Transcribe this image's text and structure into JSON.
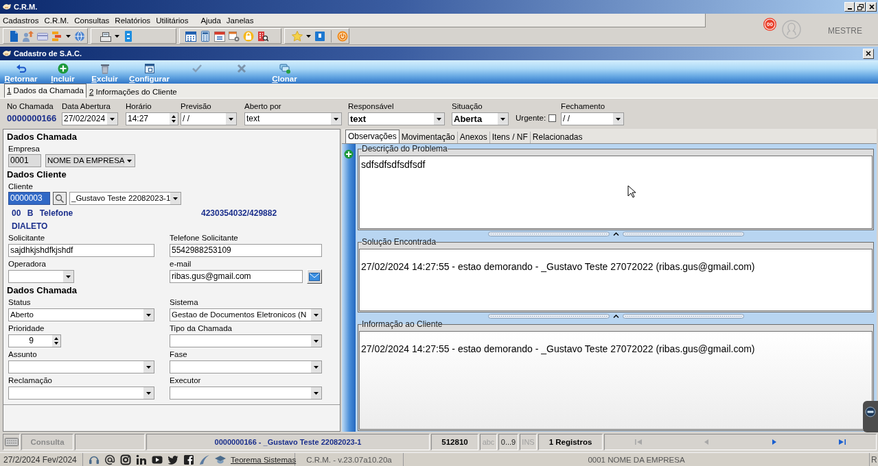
{
  "window": {
    "title": "C.R.M."
  },
  "menu": [
    "Cadastros",
    "C.R.M.",
    "Consultas",
    "Relatórios",
    "Utilitários",
    "Ajuda",
    "Janelas"
  ],
  "user": {
    "notifications": "00",
    "name": "MESTRE"
  },
  "form_window": {
    "title": "Cadastro de S.A.C."
  },
  "actions": [
    {
      "label": "Retornar",
      "disabled": false
    },
    {
      "label": "Incluir",
      "disabled": false
    },
    {
      "label": "Excluir",
      "disabled": false
    },
    {
      "label": "Configurar",
      "disabled": false
    },
    {
      "disabled": true
    },
    {
      "disabled": true
    },
    {
      "label": "Clonar",
      "disabled": false
    }
  ],
  "tabs": [
    {
      "label": "1 Dados da Chamada",
      "selected": true
    },
    {
      "label": "2 Informações do Cliente",
      "selected": false
    }
  ],
  "header_fields": [
    {
      "kind": "display",
      "label": "No Chamada",
      "value": "0000000166"
    },
    {
      "kind": "dropdown",
      "label": "Data Abertura",
      "value": "27/02/2024",
      "bold": false
    },
    {
      "kind": "spinner",
      "label": "Horário",
      "value": "14:27"
    },
    {
      "kind": "dropdown",
      "label": "Previsão",
      "value": "/ /",
      "bold": false
    },
    {
      "kind": "dropdown",
      "label": "Aberto por",
      "value": "text",
      "bold": false
    },
    {
      "kind": "dropdown",
      "label": "Responsável",
      "value": "text",
      "bold": true
    },
    {
      "kind": "dropdown",
      "label": "Situação",
      "value": "Aberta",
      "bold": true
    },
    {
      "kind": "checkbox",
      "label": "Urgente:",
      "checked": false
    },
    {
      "kind": "dropdown",
      "label": "Fechamento",
      "value": "/ /",
      "bold": false
    }
  ],
  "left_panel": {
    "company_heading": "Dados Chamada",
    "company": {
      "label": "Empresa",
      "code": "0001",
      "name": "NOME DA EMPRESA",
      "disabled": true
    },
    "client_heading": "Dados Cliente",
    "client": {
      "label": "Cliente",
      "code": "0000003",
      "code_selected": true,
      "name": "_Gustavo Teste 22082023-1",
      "info": "00 B Telefone",
      "phones": "4230354032/429882",
      "note": "DIALETO"
    },
    "contact_fields": [
      {
        "kind": "text",
        "label": "Solicitante",
        "value": "sajdhkjshdfkjshdf"
      },
      {
        "kind": "text",
        "label": "Telefone Solicitante",
        "value": "5542988253109"
      },
      {
        "kind": "dropdown",
        "label": "Operadora"
      },
      {
        "kind": "email",
        "label": "e-mail",
        "value": "ribas.gus@gmail.com"
      }
    ],
    "call_heading": "Dados Chamada",
    "call_fields": [
      {
        "kind": "dropdown",
        "label": "Status",
        "value": "Aberto"
      },
      {
        "kind": "dropdown",
        "label": "Sistema",
        "value": "Gestao de Documentos Eletronicos (N"
      },
      {
        "kind": "spinner",
        "label": "Prioridade",
        "value": "9"
      },
      {
        "kind": "dropdown",
        "label": "Tipo da Chamada"
      },
      {
        "kind": "dropdown",
        "label": "Assunto"
      },
      {
        "kind": "dropdown",
        "label": "Fase"
      },
      {
        "kind": "dropdown",
        "label": "Reclamação"
      },
      {
        "kind": "dropdown",
        "label": "Executor"
      }
    ]
  },
  "detail_tabs": [
    {
      "label": "Observações",
      "selected": true
    },
    {
      "label": "Movimentação",
      "selected": false
    },
    {
      "label": "Anexos",
      "selected": false
    },
    {
      "label": "Itens / NF",
      "selected": false
    },
    {
      "label": "Relacionadas",
      "selected": false
    }
  ],
  "notes": [
    {
      "title": "Descrição do Problema",
      "text": "sdfsdfsdfsdfsdf"
    },
    {
      "title": "Solução Encontrada",
      "text": "27/02/2024 14:27:55 - estao demorando - _Gustavo Teste 27072022 (ribas.gus@gmail.com)"
    },
    {
      "title": "Informação ao Cliente",
      "text": "27/02/2024 14:27:55 - estao demorando - _Gustavo Teste 27072022 (ribas.gus@gmail.com)"
    }
  ],
  "status_bar": {
    "mode": "Consulta",
    "record": "0000000166 - _Gustavo Teste 22082023-1",
    "code": "512810",
    "indicators": [
      {
        "label": "abc",
        "on": false
      },
      {
        "label": "0...9",
        "on": true
      },
      {
        "label": "INS",
        "on": false
      }
    ],
    "count": "1 Registros",
    "navigation": [
      {
        "disabled": true
      },
      {
        "disabled": true
      },
      {
        "disabled": false
      },
      {
        "disabled": false
      }
    ]
  },
  "footer": {
    "date": "27/2/2024 Fev/2024",
    "link": "Teorema Sistemas",
    "version": "C.R.M. - v.23.07a10.20a",
    "company": "0001 NOME DA EMPRESA",
    "edge_text": "R"
  }
}
